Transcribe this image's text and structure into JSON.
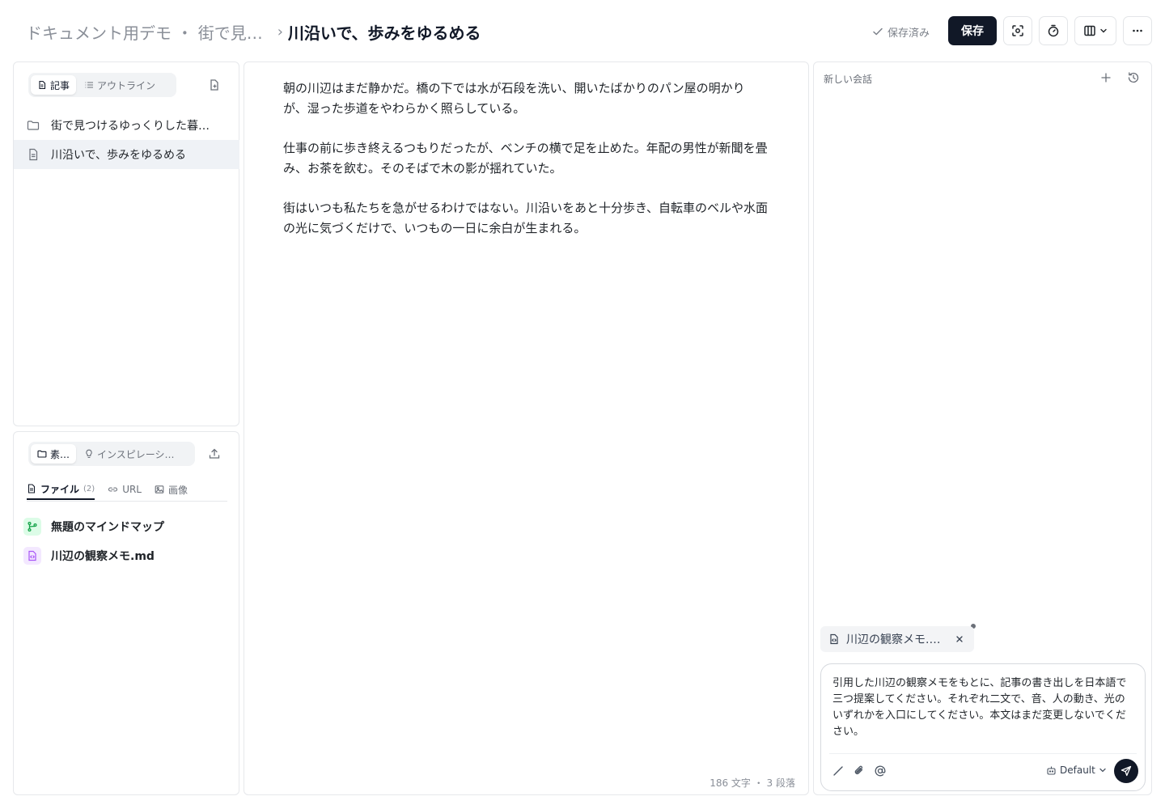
{
  "header": {
    "breadcrumb_parent": "ドキュメント用デモ ・ 街で見…",
    "breadcrumb_separator": "›",
    "title": "川沿いで、歩みをゆるめる",
    "saved_status": "保存済み",
    "save_label": "保存",
    "icons": [
      "focus-icon",
      "timer-icon",
      "columns-layout-icon",
      "more-icon"
    ]
  },
  "sidebar": {
    "tabs": [
      {
        "label": "記事",
        "icon": "document-icon",
        "active": true
      },
      {
        "label": "アウトライン",
        "icon": "list-icon",
        "active": false
      }
    ],
    "tree": [
      {
        "label": "街で見つけるゆっくりした暮…",
        "icon": "folder-icon",
        "active": false
      },
      {
        "label": "川沿いで、歩みをゆるめる",
        "icon": "document-icon",
        "active": true
      }
    ]
  },
  "materials": {
    "tabs": [
      {
        "label": "素…",
        "icon": "folder-icon",
        "active": true
      },
      {
        "label": "インスピレーシ…",
        "icon": "lightbulb-icon",
        "active": false
      }
    ],
    "subtabs": [
      {
        "label": "ファイル",
        "count": "(2)",
        "icon": "file-icon",
        "active": true
      },
      {
        "label": "URL",
        "icon": "link-icon",
        "active": false
      },
      {
        "label": "画像",
        "icon": "image-icon",
        "active": false
      }
    ],
    "files": [
      {
        "label": "無題のマインドマップ",
        "icon": "mindmap-icon"
      },
      {
        "label": "川辺の観察メモ.md",
        "icon": "code-file-icon"
      }
    ]
  },
  "editor": {
    "paragraphs": [
      "朝の川辺はまだ静かだ。橋の下では水が石段を洗い、開いたばかりのパン屋の明かりが、湿った歩道をやわらかく照らしている。",
      "仕事の前に歩き終えるつもりだったが、ベンチの横で足を止めた。年配の男性が新聞を畳み、お茶を飲む。そのそばで木の影が揺れていた。",
      "街はいつも私たちを急がせるわけではない。川沿いをあと十分歩き、自転車のベルや水面の光に気づくだけで、いつもの一日に余白が生まれる。"
    ],
    "word_count": "186 文字 ・ 3 段落"
  },
  "chat": {
    "title": "新しい会話",
    "attachment": "川辺の観察メモ.…",
    "message": "引用した川辺の観察メモをもとに、記事の書き出しを日本語で三つ提案してください。それぞれ二文で、音、人の動き、光のいずれかを入口にしてください。本文はまだ変更しないでください。",
    "model": "Default"
  },
  "colors": {
    "primary": "#111827",
    "mindmap_icon_bg": "#dcfce7",
    "mindmap_icon": "#16a34a",
    "code_file_icon_bg": "#f3e8ff",
    "code_file_icon": "#a855f7"
  }
}
